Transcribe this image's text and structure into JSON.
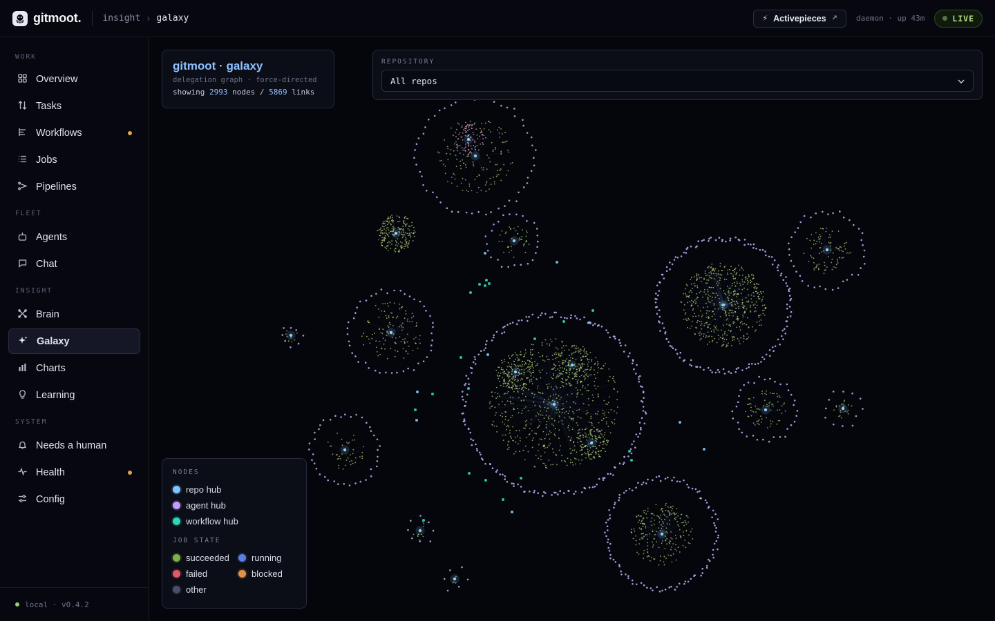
{
  "brand": {
    "name": "gitmoot.",
    "logo_icon": "octopus-icon"
  },
  "breadcrumb": {
    "section": "insight",
    "page": "galaxy"
  },
  "topbar": {
    "integration_button": "Activepieces",
    "daemon_status": "daemon · up 43m",
    "live_label": "LIVE"
  },
  "sidebar": {
    "sections": [
      {
        "label": "WORK",
        "items": [
          {
            "label": "Overview",
            "icon": "grid-icon",
            "badge": false
          },
          {
            "label": "Tasks",
            "icon": "sort-icon",
            "badge": false
          },
          {
            "label": "Workflows",
            "icon": "workflow-icon",
            "badge": true
          },
          {
            "label": "Jobs",
            "icon": "list-icon",
            "badge": false
          },
          {
            "label": "Pipelines",
            "icon": "pipeline-icon",
            "badge": false
          }
        ]
      },
      {
        "label": "FLEET",
        "items": [
          {
            "label": "Agents",
            "icon": "robot-icon",
            "badge": false
          },
          {
            "label": "Chat",
            "icon": "chat-icon",
            "badge": false
          }
        ]
      },
      {
        "label": "INSIGHT",
        "items": [
          {
            "label": "Brain",
            "icon": "brain-icon",
            "badge": false
          },
          {
            "label": "Galaxy",
            "icon": "sparkle-icon",
            "badge": false,
            "active": true
          },
          {
            "label": "Charts",
            "icon": "bar-chart-icon",
            "badge": false
          },
          {
            "label": "Learning",
            "icon": "lightbulb-icon",
            "badge": false
          }
        ]
      },
      {
        "label": "SYSTEM",
        "items": [
          {
            "label": "Needs a human",
            "icon": "bell-icon",
            "badge": false
          },
          {
            "label": "Health",
            "icon": "pulse-icon",
            "badge": true
          },
          {
            "label": "Config",
            "icon": "sliders-icon",
            "badge": false
          }
        ]
      }
    ],
    "footer": "local · v0.4.2"
  },
  "graph_card": {
    "title_repo": "gitmoot",
    "title_sep": " · ",
    "title_view": "galaxy",
    "subtitle": "delegation graph · force-directed",
    "showing_prefix": "showing ",
    "node_count": "2993",
    "nodes_mid": " nodes / ",
    "link_count": "5869",
    "links_suffix": " links"
  },
  "repo_filter": {
    "label": "REPOSITORY",
    "value": "All repos"
  },
  "legend": {
    "nodes_heading": "NODES",
    "nodes": [
      {
        "label": "repo hub",
        "color": "#7cc6ff"
      },
      {
        "label": "agent hub",
        "color": "#c59bff"
      },
      {
        "label": "workflow hub",
        "color": "#2fd6b8"
      }
    ],
    "state_heading": "JOB STATE",
    "states": [
      {
        "label": "succeeded",
        "color": "#7fb04a"
      },
      {
        "label": "running",
        "color": "#5b7fe0"
      },
      {
        "label": "failed",
        "color": "#e05a6a"
      },
      {
        "label": "blocked",
        "color": "#e0924a"
      },
      {
        "label": "other",
        "color": "#4a4f68"
      }
    ]
  },
  "colors": {
    "accent": "#8fc2ff",
    "live": "#b8d98a",
    "badge": "#e0a547",
    "repo_node": "#8fd0ff",
    "agent_ring": "#c8b2ff",
    "success_node": "#b7d67a",
    "workflow_node": "#2fd6b8"
  }
}
